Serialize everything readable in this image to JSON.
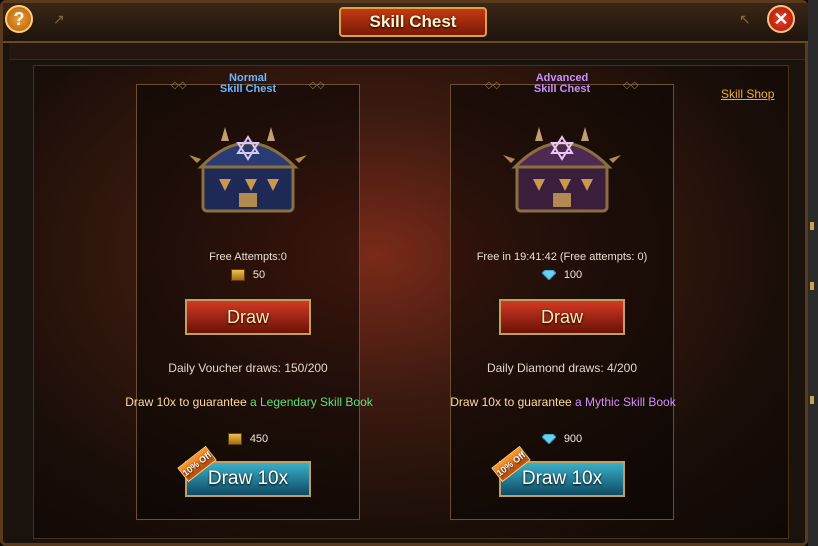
{
  "window": {
    "title": "Skill Chest",
    "help_label": "?",
    "close_label": "✕"
  },
  "skill_shop_link": "Skill Shop",
  "panels": [
    {
      "title_line1": "Normal",
      "title_line2": "Skill Chest",
      "attempts_text": "Free Attempts:0",
      "cost_icon": "voucher-icon",
      "draw_cost": "50",
      "draw_label": "Draw",
      "daily_text": "Daily Voucher draws: 150/200",
      "guarantee_prefix": "Draw 10x to guarantee",
      "guarantee_item": "a Legendary Skill Book",
      "draw10_cost": "450",
      "draw10_label": "Draw 10x",
      "discount_badge": "10% Off"
    },
    {
      "title_line1": "Advanced",
      "title_line2": "Skill Chest",
      "attempts_text": "Free in 19:41:42  (Free attempts: 0)",
      "cost_icon": "diamond-icon",
      "draw_cost": "100",
      "draw_label": "Draw",
      "daily_text": "Daily Diamond draws: 4/200",
      "guarantee_prefix": "Draw 10x to guarantee",
      "guarantee_item": "a Mythic Skill Book",
      "draw10_cost": "900",
      "draw10_label": "Draw 10x",
      "discount_badge": "10% Off"
    }
  ],
  "colors": {
    "title_plate": "#c23a12",
    "normal_title": "#6ab8ff",
    "advanced_title": "#c890ff",
    "link": "#f0b030"
  }
}
